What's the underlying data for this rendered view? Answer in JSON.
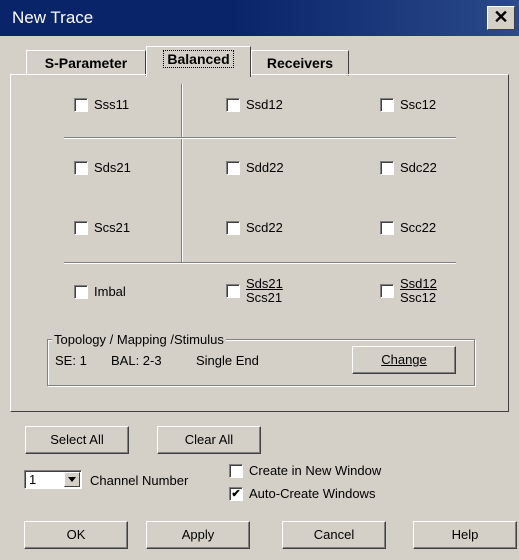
{
  "window": {
    "title": "New Trace",
    "close_label": "✕"
  },
  "tabs": [
    {
      "label": "S-Parameter",
      "active": false
    },
    {
      "label": "Balanced",
      "active": true
    },
    {
      "label": "Receivers",
      "active": false
    }
  ],
  "params": {
    "sss11": "Sss11",
    "ssd12": "Ssd12",
    "ssc12": "Ssc12",
    "sds21": "Sds21",
    "sdd22": "Sdd22",
    "sdc22": "Sdc22",
    "scs21": "Scs21",
    "scd22": "Scd22",
    "scc22": "Scc22",
    "imbal": "Imbal",
    "ratio1_top": "Sds21",
    "ratio1_bottom": "Scs21",
    "ratio2_top": "Ssd12",
    "ratio2_bottom": "Ssc12"
  },
  "topology": {
    "label": "Topology / Mapping  /Stimulus",
    "se": "SE: 1",
    "bal": "BAL: 2-3",
    "stimulus": "Single End",
    "change_label": "Change"
  },
  "footer": {
    "select_all": "Select All",
    "clear_all": "Clear All",
    "channel_value": "1",
    "channel_label": "Channel Number",
    "create_new_window": "Create in New Window",
    "create_new_window_checked": false,
    "auto_create": "Auto-Create Windows",
    "auto_create_checked": true
  },
  "buttons": {
    "ok": "OK",
    "apply": "Apply",
    "cancel": "Cancel",
    "help": "Help"
  }
}
